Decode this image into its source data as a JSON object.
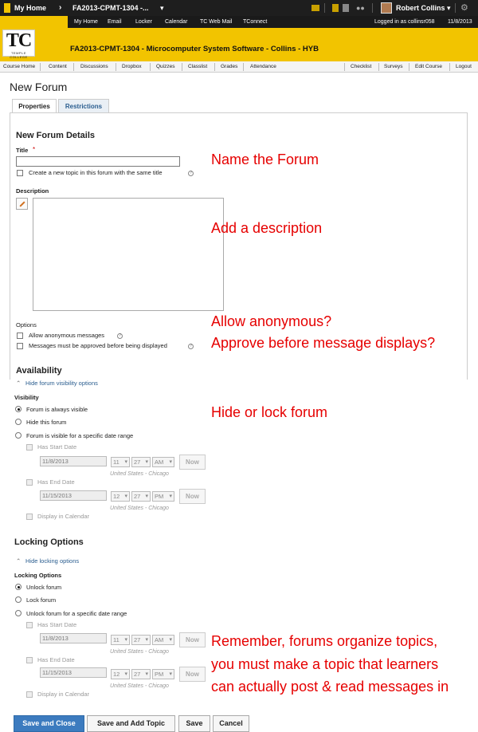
{
  "topbar": {
    "home": "My Home",
    "course": "FA2013-CPMT-1304 -...",
    "user": "Robert Collins"
  },
  "links": {
    "my_home": "My Home",
    "email": "Email",
    "locker": "Locker",
    "calendar": "Calendar",
    "webmail": "TC Web Mail",
    "tconnect": "TConnect",
    "logged_in": "Logged in as collinsr058",
    "date": "11/8/2013"
  },
  "logo": {
    "letters": "TC",
    "sub": "TEMPLE COLLEGE"
  },
  "course_title": "FA2013-CPMT-1304 - Microcomputer System Software - Collins - HYB",
  "nav": [
    "Course Home",
    "Content",
    "Discussions",
    "Dropbox",
    "Quizzes",
    "Classlist",
    "Grades",
    "Attendance",
    "Checklist",
    "Surveys",
    "Edit Course",
    "Logout"
  ],
  "page": {
    "title": "New Forum"
  },
  "tabs": [
    "Properties",
    "Restrictions"
  ],
  "details": {
    "heading": "New Forum Details",
    "title_label": "Title",
    "create_topic": "Create a new topic in this forum with the same title",
    "description": "Description",
    "options": "Options",
    "anon": "Allow anonymous messages",
    "approve": "Messages must be approved before being displayed"
  },
  "availability": {
    "heading": "Availability",
    "hide_link": "Hide forum visibility options",
    "visibility": "Visibility",
    "opt_visible": "Forum is always visible",
    "opt_hide": "Hide this forum",
    "opt_range": "Forum is visible for a specific date range",
    "has_start": "Has Start Date",
    "start_date": "11/8/2013",
    "start_hour": "11",
    "start_min": "27",
    "start_ampm": "AM",
    "now": "Now",
    "timezone": "United States - Chicago",
    "has_end": "Has End Date",
    "end_date": "11/15/2013",
    "end_hour": "12",
    "end_min": "27",
    "end_ampm": "PM",
    "display_cal": "Display in Calendar"
  },
  "locking": {
    "heading": "Locking Options",
    "hide_link": "Hide locking options",
    "sub": "Locking Options",
    "opt_unlock": "Unlock forum",
    "opt_lock": "Lock forum",
    "opt_range": "Unlock forum for a specific date range",
    "has_start": "Has Start Date",
    "start_date": "11/8/2013",
    "start_hour": "11",
    "start_min": "27",
    "start_ampm": "AM",
    "now": "Now",
    "timezone": "United States - Chicago",
    "has_end": "Has End Date",
    "end_date": "11/15/2013",
    "end_hour": "12",
    "end_min": "27",
    "end_ampm": "PM",
    "display_cal": "Display in Calendar"
  },
  "annotations": {
    "name": "Name the Forum",
    "desc": "Add a description",
    "anon": "Allow anonymous?",
    "approve": "Approve before message displays?",
    "hide": "Hide or lock forum",
    "rem1": "Remember, forums organize topics,",
    "rem2": "you must make a topic that learners",
    "rem3": "can actually post & read messages in"
  },
  "buttons": {
    "save_close": "Save and Close",
    "save_add": "Save and Add Topic",
    "save": "Save",
    "cancel": "Cancel"
  },
  "colors": {
    "brand_yellow": "#f2c400",
    "annotation_red": "#e60000",
    "primary_button": "#3c7bbf"
  }
}
